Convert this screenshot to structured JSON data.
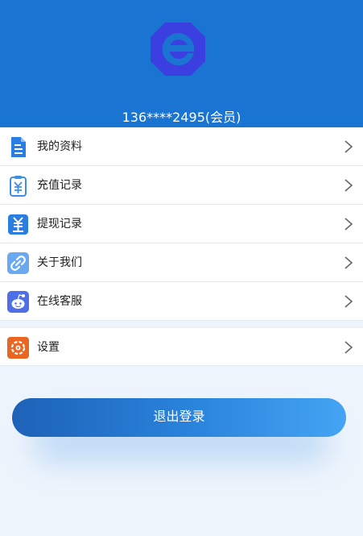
{
  "header": {
    "user_line": "136****2495(会员)",
    "background_color": "#1a74d2",
    "logo_icon": "e-logo-icon"
  },
  "menu": {
    "items": [
      {
        "label": "我的资料",
        "icon": "document-icon"
      },
      {
        "label": "充值记录",
        "icon": "recharge-clipboard-icon"
      },
      {
        "label": "提现记录",
        "icon": "withdraw-record-icon"
      },
      {
        "label": "关于我们",
        "icon": "link-icon"
      },
      {
        "label": "在线客服",
        "icon": "customer-service-icon"
      }
    ],
    "settings": {
      "label": "设置",
      "icon": "settings-icon"
    }
  },
  "logout": {
    "label": "退出登录"
  }
}
